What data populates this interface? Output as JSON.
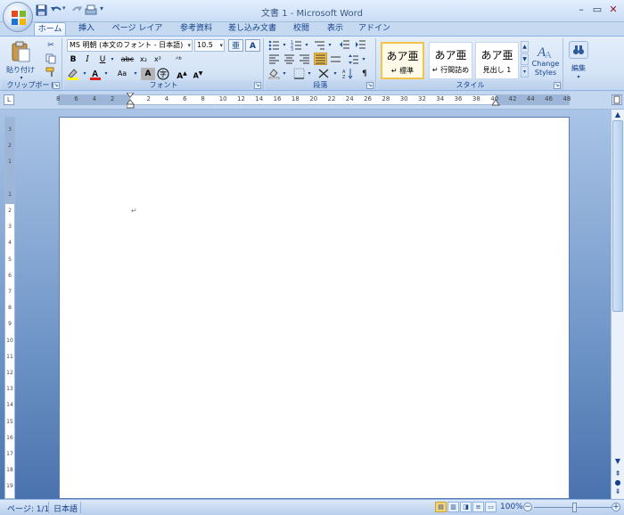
{
  "title": "文書 1 - Microsoft Word",
  "quick_access": [
    {
      "icon": "save-icon"
    },
    {
      "icon": "undo-icon"
    },
    {
      "icon": "redo-icon"
    },
    {
      "icon": "print-icon"
    },
    {
      "icon": "customize-icon"
    }
  ],
  "tabs": [
    {
      "label": "ホーム",
      "active": true
    },
    {
      "label": "挿入"
    },
    {
      "label": "ページ レイアウト"
    },
    {
      "label": "参考資料"
    },
    {
      "label": "差し込み文書"
    },
    {
      "label": "校閲"
    },
    {
      "label": "表示"
    },
    {
      "label": "アドイン"
    }
  ],
  "ribbon": {
    "clipboard": {
      "paste_label": "貼り付け",
      "group_label": "クリップボード"
    },
    "font": {
      "font_name": "MS 明朝 (本文のフォント - 日本語)",
      "font_size": "10.5",
      "group_label": "フォント",
      "bold": "B",
      "italic": "I",
      "underline": "U",
      "strike": "abc",
      "subscript": "x₂",
      "superscript": "x²",
      "grow": "A",
      "shrink": "A",
      "char_shade": "A",
      "change_case": "Aa"
    },
    "paragraph": {
      "group_label": "段落"
    },
    "styles": {
      "group_label": "スタイル",
      "items": [
        {
          "sample": "あア亜",
          "name": "↵ 標準",
          "selected": true
        },
        {
          "sample": "あア亜",
          "name": "↵ 行間詰め"
        },
        {
          "sample": "あア亜",
          "name": "見出し 1"
        }
      ],
      "change_styles_label": "Change Styles"
    },
    "editing": {
      "label": "編集"
    }
  },
  "ruler_numbers": [
    "8",
    "6",
    "4",
    "2",
    "",
    "2",
    "4",
    "6",
    "8",
    "10",
    "12",
    "14",
    "16",
    "18",
    "20",
    "22",
    "24",
    "26",
    "28",
    "30",
    "32",
    "34",
    "36",
    "38",
    "40",
    "42",
    "44",
    "46",
    "48"
  ],
  "vruler_numbers": [
    "3",
    "2",
    "1",
    "",
    "1",
    "2",
    "3",
    "4",
    "5",
    "6",
    "7",
    "8",
    "9",
    "10",
    "11",
    "12",
    "13",
    "14",
    "15",
    "16",
    "17",
    "18",
    "19"
  ],
  "document": {
    "paragraph_mark": "↵"
  },
  "status": {
    "page": "ページ: 1/1",
    "language": "日本語",
    "zoom": "100%"
  },
  "colors": {
    "accent": "#15428b",
    "ribbon": "#d4e3f6",
    "doc_bg": "#6f95c7"
  }
}
